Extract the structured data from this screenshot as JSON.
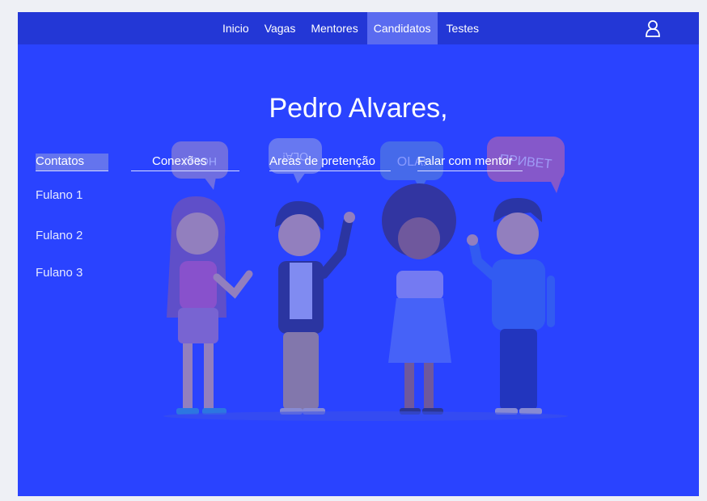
{
  "nav": {
    "items": [
      {
        "label": "Inicio",
        "active": false
      },
      {
        "label": "Vagas",
        "active": false
      },
      {
        "label": "Mentores",
        "active": false
      },
      {
        "label": "Candidatos",
        "active": true
      },
      {
        "label": "Testes",
        "active": false
      }
    ],
    "user_icon": "user-icon"
  },
  "profile": {
    "greeting": "Pedro Alvares,"
  },
  "tabs": [
    {
      "label": "Contatos",
      "active": true
    },
    {
      "label": "Conexões",
      "active": false
    },
    {
      "label": "Areas de pretenção",
      "active": false
    },
    {
      "label": "Falar com mentor",
      "active": false
    }
  ],
  "contacts": [
    "Fulano 1",
    "Fulano 2",
    "Fulano 3"
  ],
  "illustration": {
    "bubbles": [
      "HOLA!",
      "OLA!",
      "OLA!",
      "ПРИВЕТ"
    ]
  },
  "colors": {
    "background": "#2a43ff",
    "topbar": "#2337d6",
    "active_nav": "#5a6bf0",
    "page_bg": "#eef0f5"
  }
}
